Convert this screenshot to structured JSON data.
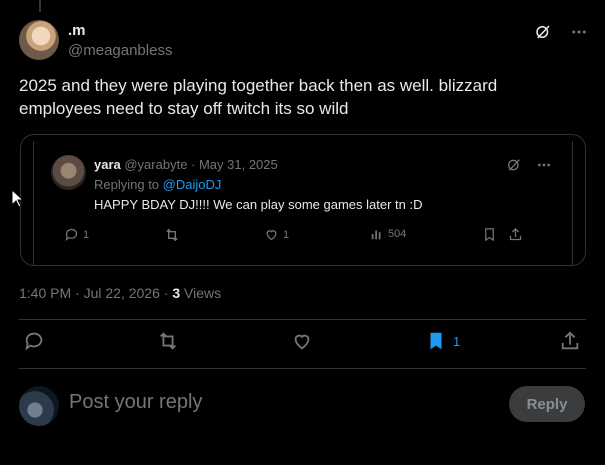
{
  "post": {
    "display_name": ".m",
    "handle": "@meaganbless",
    "text": "2025 and they were playing together back then as well. blizzard employees need to stay off twitch its so wild",
    "timestamp": "1:40 PM · Jul 22, 2026 · ",
    "views_count": "3",
    "views_label": " Views"
  },
  "quote": {
    "name": "yara",
    "meta": " @yarabyte · May 31, 2025",
    "replying_prefix": "Replying to ",
    "replying_handle": "@DaijoDJ",
    "text": "HAPPY BDAY DJ!!!! We can play some games later tn :D",
    "replies": "1",
    "likes": "1",
    "views": "504"
  },
  "actions": {
    "bookmarks": "1"
  },
  "composer": {
    "placeholder": "Post your reply",
    "button": "Reply"
  },
  "colors": {
    "accent": "#1d9bf0",
    "muted": "#71767b",
    "text": "#e7e9ea",
    "border": "#2f3336"
  }
}
